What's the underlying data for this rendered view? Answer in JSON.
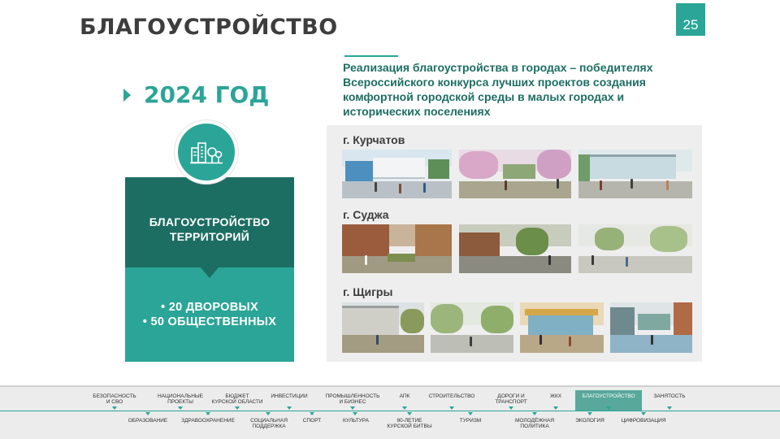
{
  "header": {
    "title": "БЛАГОУСТРОЙСТВО",
    "page_number": "25"
  },
  "year_label": "2024 ГОД",
  "icon": "city-buildings-icon",
  "category": {
    "line1": "БЛАГОУСТРОЙСТВО",
    "line2": "ТЕРРИТОРИЙ"
  },
  "counts": {
    "line1": "• 20 ДВОРОВЫХ",
    "line2": "• 50 ОБЩЕСТВЕННЫХ"
  },
  "description": {
    "line1": "Реализация благоустройства в городах – победителях",
    "line2": "Всероссийского конкурса лучших проектов создания",
    "line3": "комфортной городской среды в малых городах и",
    "line4": "исторических поселениях"
  },
  "cities": [
    {
      "name": "г. Курчатов"
    },
    {
      "name": "г. Суджа"
    },
    {
      "name": "г. Щигры"
    }
  ],
  "colors": {
    "accent": "#2ba597",
    "dark": "#1d6e62",
    "text": "#3d3d3d"
  },
  "nav_top": [
    {
      "line1": "БЕЗОПАСНОСТЬ",
      "line2": "И СВО"
    },
    {
      "line1": "НАЦИОНАЛЬНЫЕ",
      "line2": "ПРОЕКТЫ"
    },
    {
      "line1": "БЮДЖЕТ",
      "line2": "КУРСКОЙ ОБЛАСТИ"
    },
    {
      "line1": "ИНВЕСТИЦИИ",
      "line2": ""
    },
    {
      "line1": "ПРОМЫШЛЕННОСТЬ",
      "line2": "И БИЗНЕС"
    },
    {
      "line1": "АПК",
      "line2": ""
    },
    {
      "line1": "СТРОИТЕЛЬСТВО",
      "line2": ""
    },
    {
      "line1": "ДОРОГИ И",
      "line2": "ТРАНСПОРТ"
    },
    {
      "line1": "ЖКХ",
      "line2": ""
    },
    {
      "line1": "БЛАГОУСТРОЙСТВО",
      "line2": ""
    },
    {
      "line1": "ЗАНЯТОСТЬ",
      "line2": ""
    }
  ],
  "nav_bottom": [
    {
      "line1": "ОБРАЗОВАНИЕ",
      "line2": ""
    },
    {
      "line1": "ЗДРАВООХРАНЕНИЕ",
      "line2": ""
    },
    {
      "line1": "СОЦИАЛЬНАЯ",
      "line2": "ПОДДЕРЖКА"
    },
    {
      "line1": "СПОРТ",
      "line2": ""
    },
    {
      "line1": "КУЛЬТУРА",
      "line2": ""
    },
    {
      "line1": "80-ЛЕТИЕ",
      "line2": "КУРСКОЙ БИТВЫ"
    },
    {
      "line1": "ТУРИЗМ",
      "line2": ""
    },
    {
      "line1": "МОЛОДЁЖНАЯ",
      "line2": "ПОЛИТИКА"
    },
    {
      "line1": "ЭКОЛОГИЯ",
      "line2": ""
    },
    {
      "line1": "ЦИФРОВИЗАЦИЯ",
      "line2": ""
    }
  ]
}
